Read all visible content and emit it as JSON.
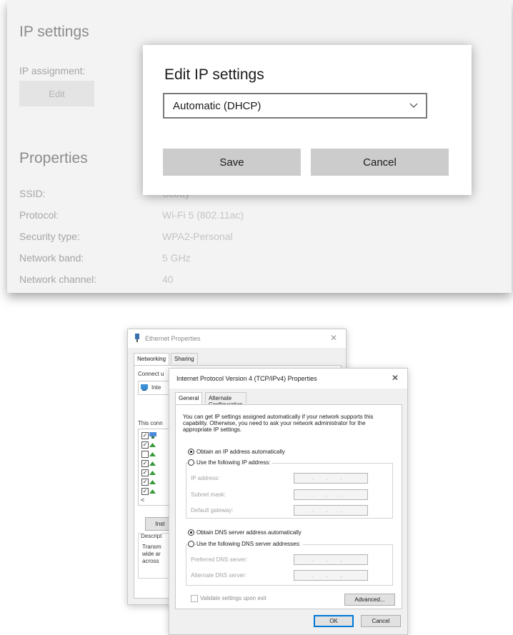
{
  "settings": {
    "ip_settings_heading": "IP settings",
    "ip_assignment_label": "IP assignment:",
    "edit_button": "Edit",
    "properties_heading": "Properties",
    "properties": [
      {
        "key": "SSID:",
        "value": "Scotty"
      },
      {
        "key": "Protocol:",
        "value": "Wi-Fi 5 (802.11ac)"
      },
      {
        "key": "Security type:",
        "value": "WPA2-Personal"
      },
      {
        "key": "Network band:",
        "value": "5 GHz"
      },
      {
        "key": "Network channel:",
        "value": "40"
      }
    ]
  },
  "edit_dialog": {
    "title": "Edit IP settings",
    "selected_option": "Automatic (DHCP)",
    "save_label": "Save",
    "cancel_label": "Cancel"
  },
  "ethernet_window": {
    "title": "Ethernet Properties",
    "tabs": [
      "Networking",
      "Sharing"
    ],
    "connect_fragment": "Connect u",
    "adapter_fragment": "Inte",
    "this_conn_fragment": "This conn",
    "install_fragment": "Inst",
    "descr_fragment": "Descript",
    "descr_lines": [
      "Transm",
      "wide ar",
      "across"
    ]
  },
  "ipv4_window": {
    "title": "Internet Protocol Version 4 (TCP/IPv4) Properties",
    "tabs": [
      "General",
      "Alternate Configuration"
    ],
    "description": "You can get IP settings assigned automatically if your network supports this capability. Otherwise, you need to ask your network administrator for the appropriate IP settings.",
    "obtain_ip_auto": "Obtain an IP address automatically",
    "use_following_ip": "Use the following IP address:",
    "ip_address_label": "IP address:",
    "subnet_mask_label": "Subnet mask:",
    "default_gateway_label": "Default gateway:",
    "obtain_dns_auto": "Obtain DNS server address automatically",
    "use_following_dns": "Use the following DNS server addresses:",
    "preferred_dns_label": "Preferred DNS server:",
    "alternate_dns_label": "Alternate DNS server:",
    "validate_label": "Validate settings upon exit",
    "advanced_button": "Advanced...",
    "ok_button": "OK",
    "cancel_button": "Cancel"
  }
}
